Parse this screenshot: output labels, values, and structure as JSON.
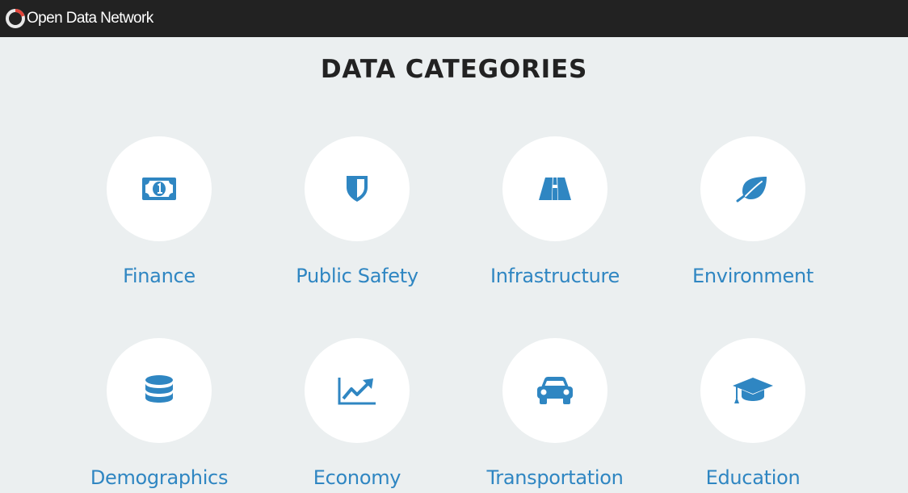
{
  "header": {
    "brand_name": "Open Data Network",
    "logo_colors": {
      "ring": "#e8e8e8",
      "accent": "#e2443a"
    }
  },
  "page": {
    "title": "DATA CATEGORIES",
    "accent_color": "#2f86c2"
  },
  "categories": [
    {
      "label": "Finance",
      "icon": "money-bill-icon"
    },
    {
      "label": "Public Safety",
      "icon": "shield-icon"
    },
    {
      "label": "Infrastructure",
      "icon": "road-icon"
    },
    {
      "label": "Environment",
      "icon": "leaf-icon"
    },
    {
      "label": "Demographics",
      "icon": "database-icon"
    },
    {
      "label": "Economy",
      "icon": "line-chart-icon"
    },
    {
      "label": "Transportation",
      "icon": "car-icon"
    },
    {
      "label": "Education",
      "icon": "graduation-cap-icon"
    }
  ]
}
